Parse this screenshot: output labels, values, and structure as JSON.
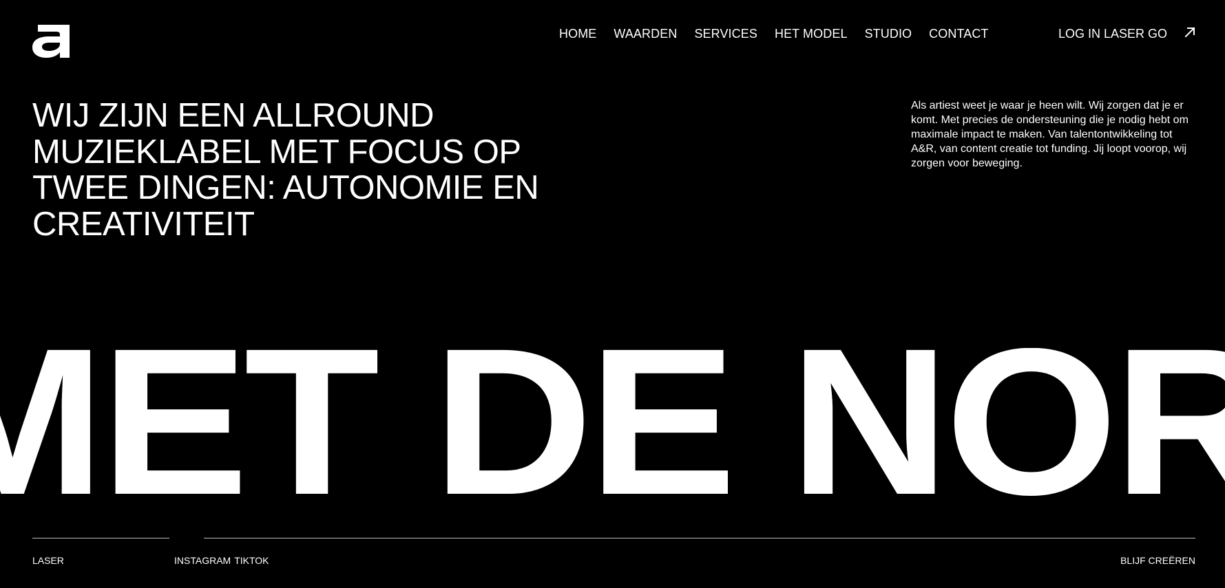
{
  "header": {
    "logo_icon": "laser-a-logo-icon",
    "nav": [
      {
        "label": "HOME"
      },
      {
        "label": "WAARDEN"
      },
      {
        "label": "SERVICES"
      },
      {
        "label": "HET MODEL"
      },
      {
        "label": "STUDIO"
      },
      {
        "label": "CONTACT"
      }
    ],
    "login_label": "LOG IN LASER GO",
    "login_icon": "arrow-up-right-icon"
  },
  "hero": {
    "headline": "WIJ ZIJN EEN ALLROUND MUZIEKLABEL MET FOCUS OP TWEE DINGEN: AUTONOMIE EN CREATIVITEIT",
    "intro": "Als artiest weet je waar je heen wilt. Wij zorgen dat je er komt. Met precies de ondersteuning die je nodig hebt om maximale impact te maken. Van talentontwikkeling tot A&R, van content creatie tot funding. Jij loopt voorop, wij zorgen voor beweging."
  },
  "marquee": {
    "text": "MET DE NOR"
  },
  "footer": {
    "brand": "LASER",
    "social": [
      "INSTAGRAM",
      "TIKTOK"
    ],
    "tagline": "BLIJF CREËREN"
  },
  "colors": {
    "background": "#000000",
    "foreground": "#ffffff",
    "rule": "#bdbdbd"
  }
}
